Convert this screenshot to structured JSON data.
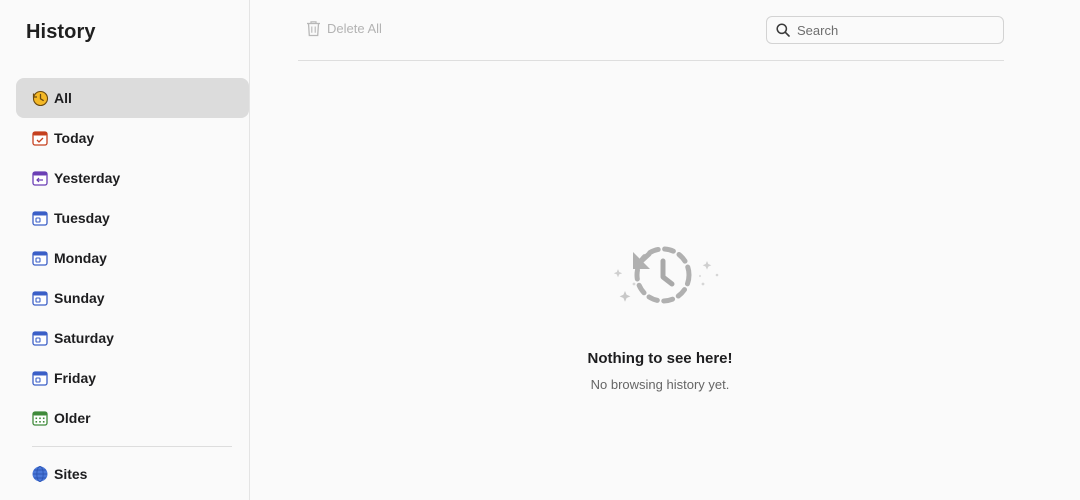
{
  "sidebar": {
    "title": "History",
    "items": [
      {
        "label": "All",
        "icon": "history-clock-icon",
        "active": true
      },
      {
        "label": "Today",
        "icon": "calendar-check-icon"
      },
      {
        "label": "Yesterday",
        "icon": "calendar-back-icon"
      },
      {
        "label": "Tuesday",
        "icon": "calendar-icon"
      },
      {
        "label": "Monday",
        "icon": "calendar-icon"
      },
      {
        "label": "Sunday",
        "icon": "calendar-icon"
      },
      {
        "label": "Saturday",
        "icon": "calendar-icon"
      },
      {
        "label": "Friday",
        "icon": "calendar-icon"
      },
      {
        "label": "Older",
        "icon": "calendar-grid-icon"
      }
    ],
    "sites": {
      "label": "Sites",
      "icon": "globe-icon"
    }
  },
  "toolbar": {
    "delete_all_label": "Delete All",
    "search_placeholder": "Search",
    "search_value": ""
  },
  "empty_state": {
    "title": "Nothing to see here!",
    "subtitle": "No browsing history yet."
  },
  "colors": {
    "active_bg": "#dcdcdc",
    "today_icon": "#c5401f",
    "yesterday_icon": "#6b3fb5",
    "weekday_icon": "#3b5fc7",
    "older_icon": "#3f8a3a",
    "history_icon": "#f4b826",
    "globe_icon": "#4a78d9"
  }
}
